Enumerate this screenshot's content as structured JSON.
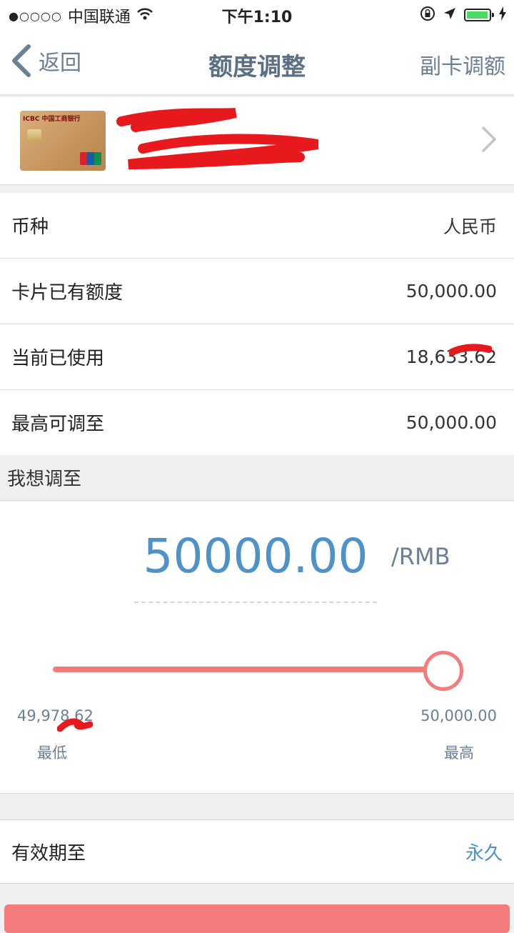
{
  "status_bar": {
    "carrier": "中国联通",
    "time": "下午1:10",
    "signal": "●○○○○",
    "battery_color": "#4cd964",
    "battery_level": 0.95
  },
  "nav": {
    "back_label": "返回",
    "title": "额度调整",
    "right_label": "副卡调额"
  },
  "rows": [
    {
      "label": "币种",
      "value": "人民币"
    },
    {
      "label": "卡片已有额度",
      "value": "50,000.00"
    },
    {
      "label": "当前已使用",
      "value": "18,633.62"
    },
    {
      "label": "最高可调至",
      "value": "50,000.00"
    }
  ],
  "adjust": {
    "header": "我想调至",
    "amount": "50000.00",
    "unit": "/RMB",
    "min_value": "49,978.62",
    "max_value": "50,000.00",
    "min_label": "最低",
    "max_label": "最高",
    "slider_position": 1.0
  },
  "expiry": {
    "label": "有效期至",
    "value": "永久"
  },
  "colors": {
    "accent_blue": "#4e92c8",
    "slider_red": "#f47c7c",
    "nav_text": "#6b7f95"
  },
  "icons": [
    "back-chevron-icon",
    "wifi-icon",
    "lock-rotation-icon",
    "location-arrow-icon",
    "battery-icon",
    "charging-icon",
    "chevron-right-icon"
  ]
}
